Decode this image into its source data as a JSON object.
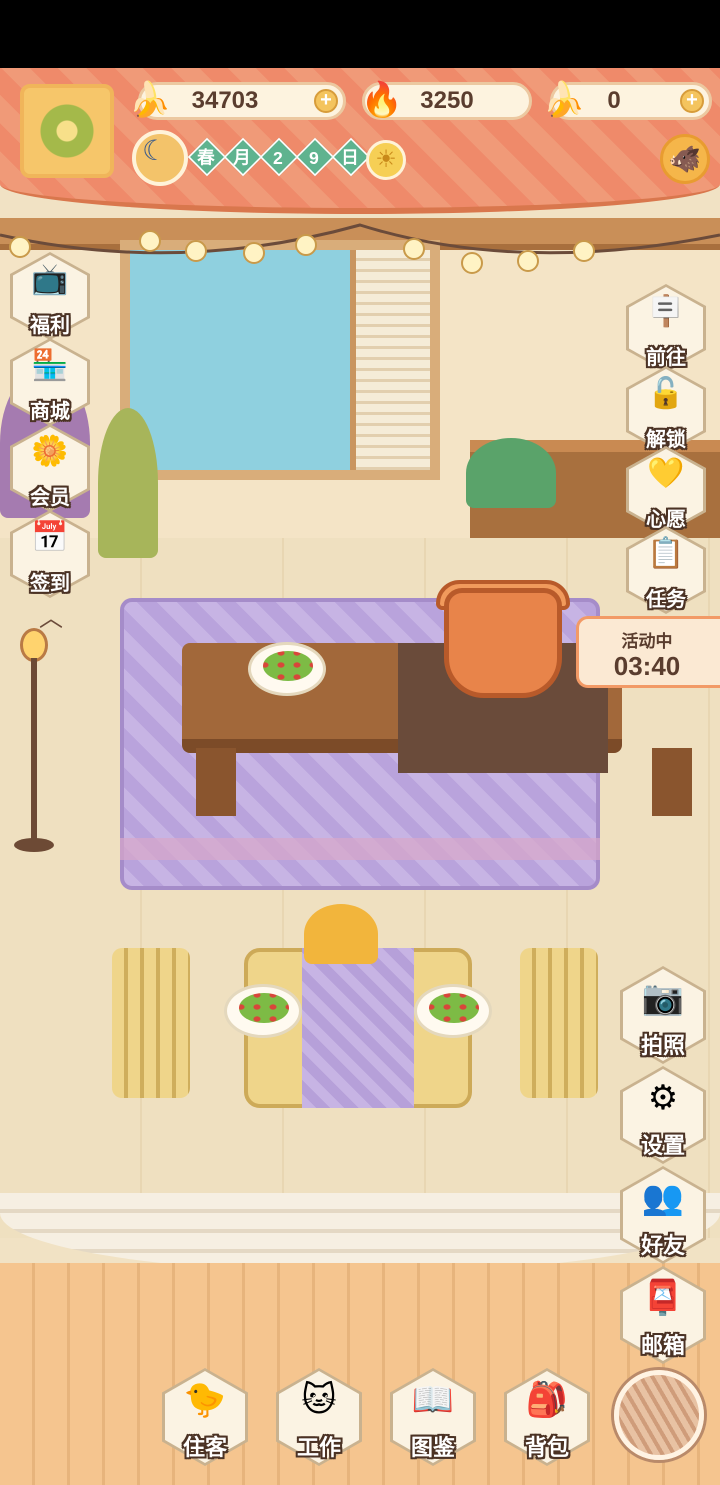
{
  "header": {
    "resources": [
      {
        "icon": "banana-icon",
        "value": "34703",
        "plus": "+"
      },
      {
        "icon": "flame-icon",
        "value": "3250",
        "plus": "+"
      },
      {
        "icon": "blue-banana-icon",
        "value": "0",
        "plus": "+"
      }
    ],
    "date": {
      "season": "春",
      "month_char": "月",
      "d1": "2",
      "d2": "9",
      "day_char": "日"
    },
    "weather": "sun-icon"
  },
  "left_menu": [
    {
      "label": "福利",
      "icon": "tv-icon"
    },
    {
      "label": "商城",
      "icon": "shop-icon"
    },
    {
      "label": "会员",
      "icon": "flower-badge-icon"
    },
    {
      "label": "签到",
      "icon": "calendar-icon"
    }
  ],
  "right_menu_top": [
    {
      "label": "前往",
      "icon": "signboard-icon"
    },
    {
      "label": "解锁",
      "icon": "unlock-icon"
    },
    {
      "label": "心愿",
      "icon": "heart-book-icon"
    },
    {
      "label": "任务",
      "icon": "task-board-icon"
    }
  ],
  "activity": {
    "status": "活动中",
    "timer": "03:40"
  },
  "right_menu_bottom": [
    {
      "label": "拍照",
      "icon": "camera-icon"
    },
    {
      "label": "设置",
      "icon": "gear-icon"
    },
    {
      "label": "好友",
      "icon": "friends-icon"
    },
    {
      "label": "邮箱",
      "icon": "mailbox-icon"
    }
  ],
  "bottom_nav": [
    {
      "label": "住客",
      "icon": "guest-icon"
    },
    {
      "label": "工作",
      "icon": "cat-work-icon"
    },
    {
      "label": "图鉴",
      "icon": "book-icon"
    },
    {
      "label": "背包",
      "icon": "backpack-icon"
    }
  ],
  "colors": {
    "header": "#ef8a6a",
    "label_outline": "#4b3224",
    "accent": "#f29a66"
  }
}
